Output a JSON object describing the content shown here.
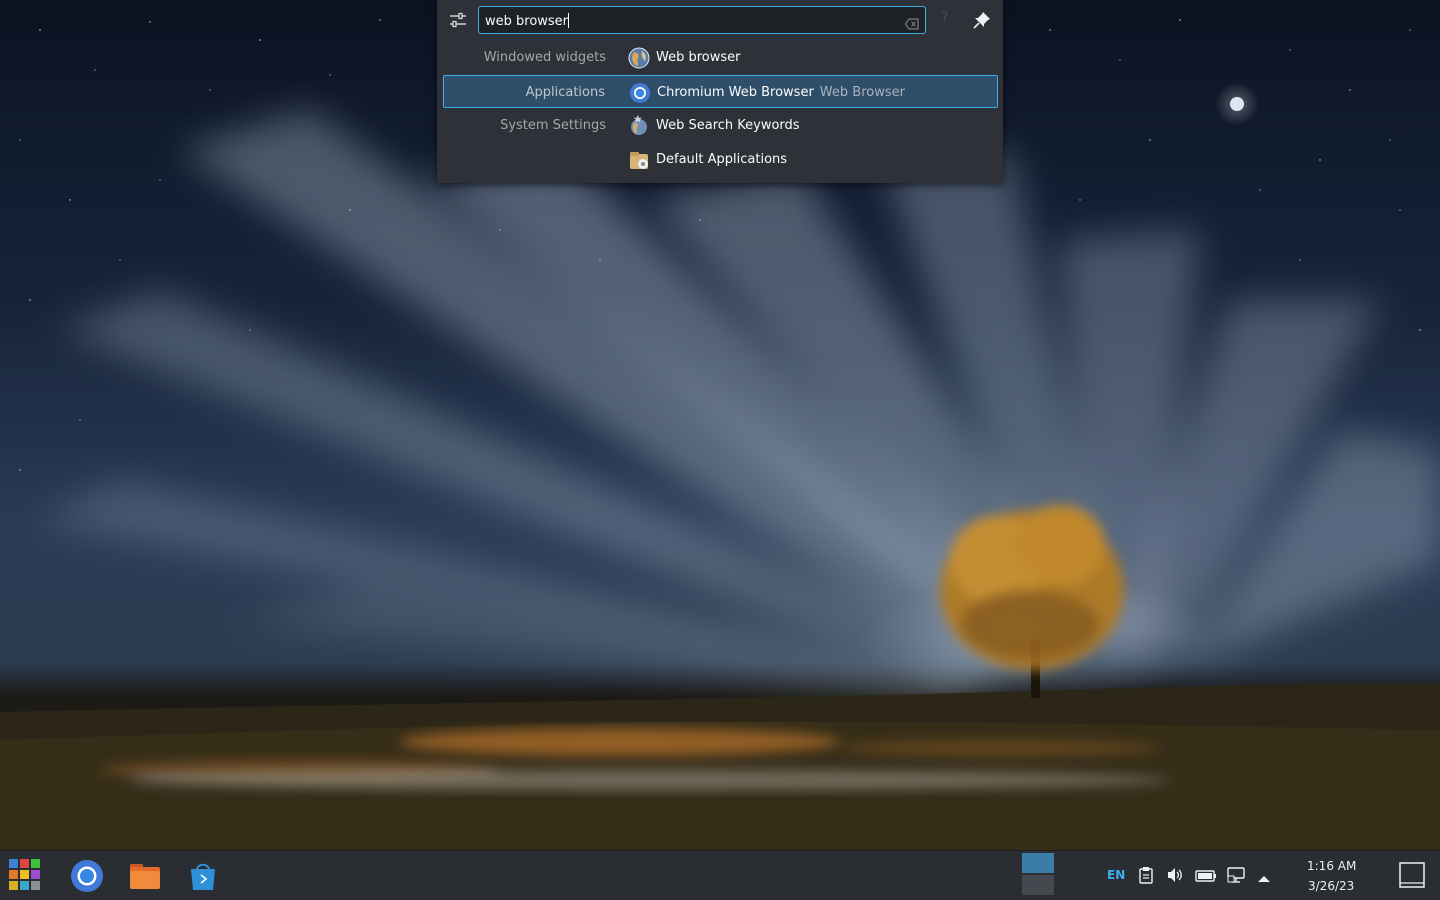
{
  "krunner": {
    "query": "web browser",
    "results": [
      {
        "category": "Windowed widgets",
        "label": "Web browser",
        "subtext": "",
        "icon": "globe-icon",
        "selected": false
      },
      {
        "category": "Applications",
        "label": "Chromium Web Browser",
        "subtext": "Web Browser",
        "icon": "chromium-icon",
        "selected": true
      },
      {
        "category": "System Settings",
        "label": "Web Search Keywords",
        "subtext": "",
        "icon": "web-search-keywords-icon",
        "selected": false
      },
      {
        "category": "",
        "label": "Default Applications",
        "subtext": "",
        "icon": "default-applications-icon",
        "selected": false
      }
    ]
  },
  "taskbar": {
    "launchers": [
      "application-launcher-icon",
      "chromium-icon",
      "file-manager-icon",
      "discover-store-icon"
    ],
    "keyboard_layout": "EN",
    "tray_icons": [
      "clipboard-icon",
      "volume-icon",
      "battery-icon",
      "network-icon",
      "expand-tray-icon"
    ],
    "time": "1:16 AM",
    "date": "3/26/23"
  },
  "colors": {
    "accent": "#3daee9",
    "panel": "#2a2e32",
    "popup": "#2e3238"
  }
}
